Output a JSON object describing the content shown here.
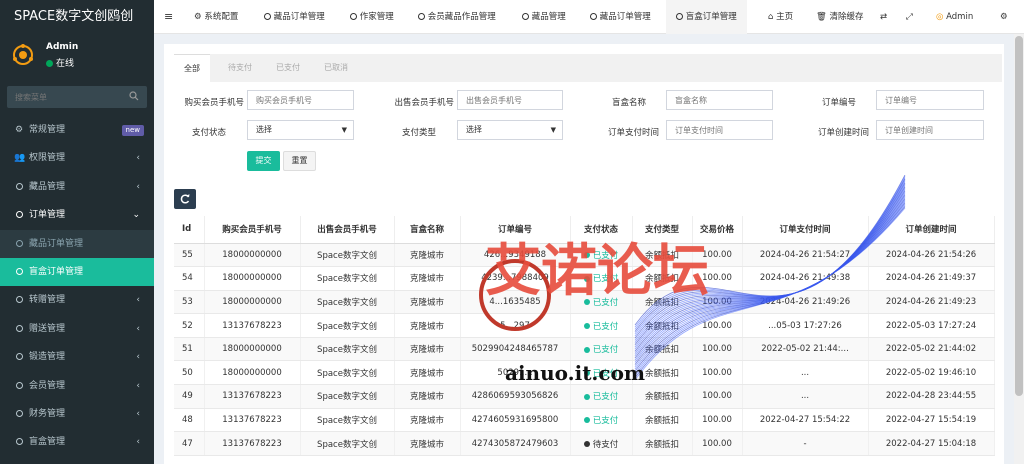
{
  "brand": "SPACE数字文创鸥创",
  "user": {
    "name": "Admin",
    "status": "在线"
  },
  "sidebar": {
    "search_placeholder": "搜索菜单",
    "items": [
      {
        "label": "常规管理",
        "badge": "new"
      },
      {
        "label": "权限管理",
        "arrow": "‹"
      },
      {
        "label": "藏品管理",
        "arrow": "‹"
      },
      {
        "label": "订单管理",
        "arrow": "›"
      },
      {
        "label": "藏品订单管理"
      },
      {
        "label": "盲盒订单管理"
      },
      {
        "label": "转赠管理",
        "arrow": "‹"
      },
      {
        "label": "赠送管理",
        "arrow": "‹"
      },
      {
        "label": "锻造管理",
        "arrow": "‹"
      },
      {
        "label": "会员管理",
        "arrow": "‹"
      },
      {
        "label": "财务管理",
        "arrow": "‹"
      },
      {
        "label": "盲盒管理",
        "arrow": "‹"
      }
    ]
  },
  "topbar": {
    "menu_icon": "≡",
    "tabs": [
      "系统配置",
      "藏品订单管理",
      "作家管理",
      "会员藏品作品管理",
      "藏品管理",
      "藏品订单管理",
      "盲盒订单管理"
    ],
    "right": {
      "home": "主页",
      "clear_cache": "清除缓存",
      "admin": "Admin"
    }
  },
  "filter_tabs": [
    "全部",
    "待支付",
    "已支付",
    "已取消"
  ],
  "filters": {
    "buyer_phone": {
      "label": "购买会员手机号",
      "placeholder": "购买会员手机号"
    },
    "seller_phone": {
      "label": "出售会员手机号",
      "placeholder": "出售会员手机号"
    },
    "box_name": {
      "label": "盲盒名称",
      "placeholder": "盲盒名称"
    },
    "order_no": {
      "label": "订单编号",
      "placeholder": "订单编号"
    },
    "pay_status": {
      "label": "支付状态",
      "value": "选择"
    },
    "pay_type": {
      "label": "支付类型",
      "value": "选择"
    },
    "pay_time": {
      "label": "订单支付时间",
      "placeholder": "订单支付时间"
    },
    "create_time": {
      "label": "订单创建时间",
      "placeholder": "订单创建时间"
    },
    "submit": "提交",
    "reset": "重置"
  },
  "table": {
    "headers": [
      "Id",
      "购买会员手机号",
      "出售会员手机号",
      "盲盒名称",
      "订单编号",
      "支付状态",
      "支付类型",
      "交易价格",
      "订单支付时间",
      "订单创建时间"
    ],
    "rows": [
      {
        "id": "55",
        "buyer": "18000000000",
        "seller": "Space数字文创",
        "box": "克隆城市",
        "order": "426...9349188",
        "status": "已支付",
        "paid": true,
        "type": "余额抵扣",
        "price": "100.00",
        "pay_time": "2024-04-26 21:54:27",
        "create_time": "2024-04-26 21:54:26"
      },
      {
        "id": "54",
        "buyer": "18000000000",
        "seller": "Space数字文创",
        "box": "克隆城市",
        "order": "4239...7988409",
        "status": "已支付",
        "paid": true,
        "type": "余额抵扣",
        "price": "100.00",
        "pay_time": "2024-04-26 21:49:38",
        "create_time": "2024-04-26 21:49:37"
      },
      {
        "id": "53",
        "buyer": "18000000000",
        "seller": "Space数字文创",
        "box": "克隆城市",
        "order": "4...1635485",
        "status": "已支付",
        "paid": true,
        "type": "余额抵扣",
        "price": "100.00",
        "pay_time": "2024-04-26 21:49:26",
        "create_time": "2024-04-26 21:49:23"
      },
      {
        "id": "52",
        "buyer": "13137678223",
        "seller": "Space数字文创",
        "box": "克隆城市",
        "order": "5...297",
        "status": "已支付",
        "paid": true,
        "type": "余额抵扣",
        "price": "100.00",
        "pay_time": "...05-03 17:27:26",
        "create_time": "2022-05-03 17:27:24"
      },
      {
        "id": "51",
        "buyer": "18000000000",
        "seller": "Space数字文创",
        "box": "克隆城市",
        "order": "5029904248465787",
        "status": "已支付",
        "paid": true,
        "type": "余额抵扣",
        "price": "100.00",
        "pay_time": "2022-05-02 21:44:...",
        "create_time": "2022-05-02 21:44:02"
      },
      {
        "id": "50",
        "buyer": "18000000000",
        "seller": "Space数字文创",
        "box": "克隆城市",
        "order": "50291...",
        "status": "已支付",
        "paid": true,
        "type": "余额抵扣",
        "price": "100.00",
        "pay_time": "...",
        "create_time": "2022-05-02 19:46:10"
      },
      {
        "id": "49",
        "buyer": "13137678223",
        "seller": "Space数字文创",
        "box": "克隆城市",
        "order": "4286069593056826",
        "status": "已支付",
        "paid": true,
        "type": "余额抵扣",
        "price": "100.00",
        "pay_time": "...",
        "create_time": "2022-04-28 23:44:55"
      },
      {
        "id": "48",
        "buyer": "13137678223",
        "seller": "Space数字文创",
        "box": "克隆城市",
        "order": "4274605931695800",
        "status": "已支付",
        "paid": true,
        "type": "余额抵扣",
        "price": "100.00",
        "pay_time": "2022-04-27 15:54:22",
        "create_time": "2022-04-27 15:54:19"
      },
      {
        "id": "47",
        "buyer": "13137678223",
        "seller": "Space数字文创",
        "box": "克隆城市",
        "order": "4274305872479603",
        "status": "待支付",
        "paid": false,
        "type": "余额抵扣",
        "price": "100.00",
        "pay_time": "-",
        "create_time": "2022-04-27 15:04:18"
      }
    ]
  },
  "watermark": {
    "title": "艾诺论坛",
    "url": "ainuo.it.com"
  },
  "colors": {
    "sidebar_bg": "#222d32",
    "accent": "#1abc9c",
    "paid": "#18bc9c"
  }
}
